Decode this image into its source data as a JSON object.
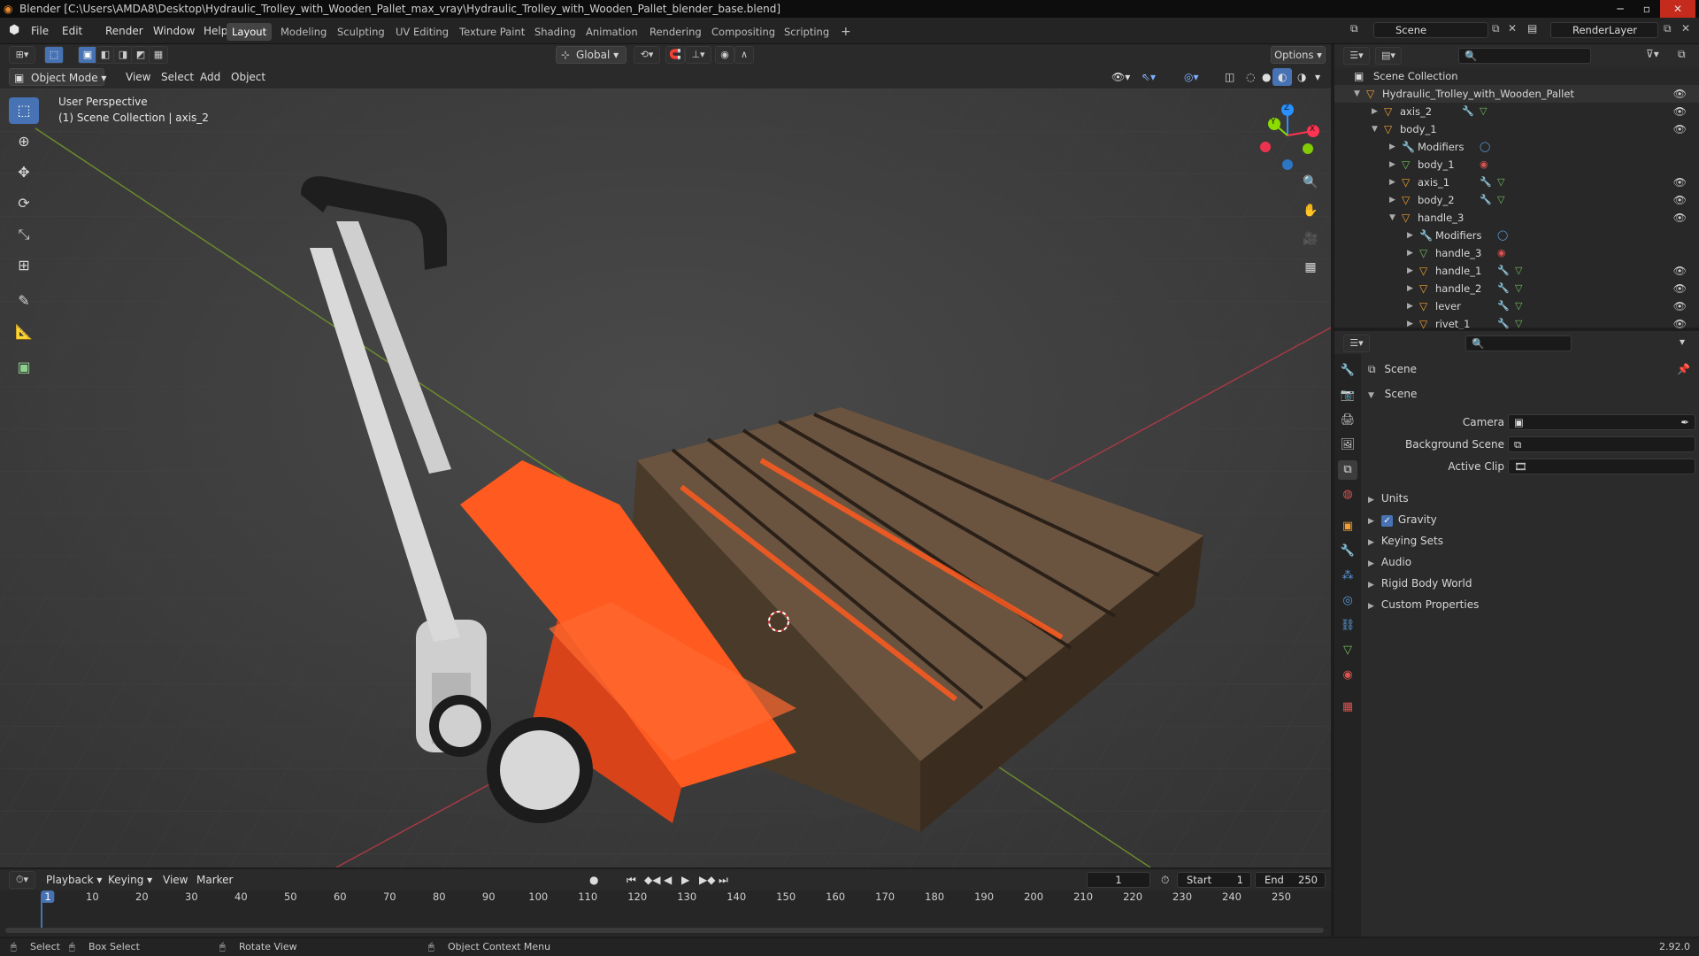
{
  "titlebar": {
    "text": "Blender [C:\\Users\\AMDA8\\Desktop\\Hydraulic_Trolley_with_Wooden_Pallet_max_vray\\Hydraulic_Trolley_with_Wooden_Pallet_blender_base.blend]"
  },
  "menus": [
    "File",
    "Edit",
    "Render",
    "Window",
    "Help"
  ],
  "workspaces": [
    "Layout",
    "Modeling",
    "Sculpting",
    "UV Editing",
    "Texture Paint",
    "Shading",
    "Animation",
    "Rendering",
    "Compositing",
    "Scripting"
  ],
  "header": {
    "scene": "Scene",
    "render_layer": "RenderLayer",
    "transform": "Global",
    "options": "Options"
  },
  "viewport_header": {
    "mode": "Object Mode",
    "menus": [
      "View",
      "Select",
      "Add",
      "Object"
    ]
  },
  "viewport": {
    "perspective": "User Perspective",
    "collection": "(1) Scene Collection | axis_2",
    "gizmo": {
      "x": "X",
      "y": "Y",
      "z": "Z"
    }
  },
  "outliner": {
    "root": "Scene Collection",
    "rows": [
      {
        "name": "Hydraulic_Trolley_with_Wooden_Pallet",
        "depth": 1,
        "icon": "object",
        "open": true,
        "eye": true
      },
      {
        "name": "axis_2",
        "depth": 2,
        "icon": "mesh",
        "open": false,
        "extras": 2,
        "eye": true
      },
      {
        "name": "body_1",
        "depth": 2,
        "icon": "mesh",
        "open": true,
        "eye": true
      },
      {
        "name": "Modifiers",
        "depth": 3,
        "icon": "wrench",
        "open": false,
        "extras": 0,
        "eye": false
      },
      {
        "name": "body_1",
        "depth": 3,
        "icon": "meshdata",
        "open": false,
        "extras": 0,
        "eye": false
      },
      {
        "name": "axis_1",
        "depth": 3,
        "icon": "mesh",
        "open": false,
        "extras": 2,
        "eye": true
      },
      {
        "name": "body_2",
        "depth": 3,
        "icon": "mesh",
        "open": false,
        "extras": 2,
        "eye": true
      },
      {
        "name": "handle_3",
        "depth": 3,
        "icon": "mesh",
        "open": true,
        "eye": true
      },
      {
        "name": "Modifiers",
        "depth": 4,
        "icon": "wrench",
        "open": false,
        "extras": 0,
        "eye": false
      },
      {
        "name": "handle_3",
        "depth": 4,
        "icon": "meshdata",
        "open": false,
        "extras": 0,
        "eye": false
      },
      {
        "name": "handle_1",
        "depth": 4,
        "icon": "mesh",
        "open": false,
        "extras": 2,
        "eye": true
      },
      {
        "name": "handle_2",
        "depth": 4,
        "icon": "mesh",
        "open": false,
        "extras": 2,
        "eye": true
      },
      {
        "name": "lever",
        "depth": 4,
        "icon": "mesh",
        "open": false,
        "extras": 2,
        "eye": true
      },
      {
        "name": "rivet_1",
        "depth": 4,
        "icon": "mesh",
        "open": false,
        "extras": 2,
        "eye": true
      }
    ]
  },
  "properties": {
    "context": "Scene",
    "panel": "Scene",
    "fields": [
      {
        "label": "Camera"
      },
      {
        "label": "Background Scene"
      },
      {
        "label": "Active Clip"
      }
    ],
    "subpanels": [
      "Units",
      "Gravity",
      "Keying Sets",
      "Audio",
      "Rigid Body World",
      "Custom Properties"
    ]
  },
  "timeline": {
    "menus": [
      "Playback",
      "Keying",
      "View",
      "Marker"
    ],
    "current_frame": "1",
    "start_label": "Start",
    "start": "1",
    "end_label": "End",
    "end": "250",
    "ticks": [
      "1",
      "10",
      "20",
      "30",
      "40",
      "50",
      "60",
      "70",
      "80",
      "90",
      "100",
      "110",
      "120",
      "130",
      "140",
      "150",
      "160",
      "170",
      "180",
      "190",
      "200",
      "210",
      "220",
      "230",
      "240",
      "250"
    ]
  },
  "statusbar": {
    "select": "Select",
    "box_select": "Box Select",
    "rotate": "Rotate View",
    "context_menu": "Object Context Menu",
    "version": "2.92.0"
  },
  "colors": {
    "accent": "#4772b3",
    "orange": "#ff5a1f",
    "pallet": "#5a4632",
    "mesh_green": "#6fbf5a",
    "x_axis": "#ff3352",
    "y_axis": "#8bdc00",
    "z_axis": "#2890ff"
  }
}
